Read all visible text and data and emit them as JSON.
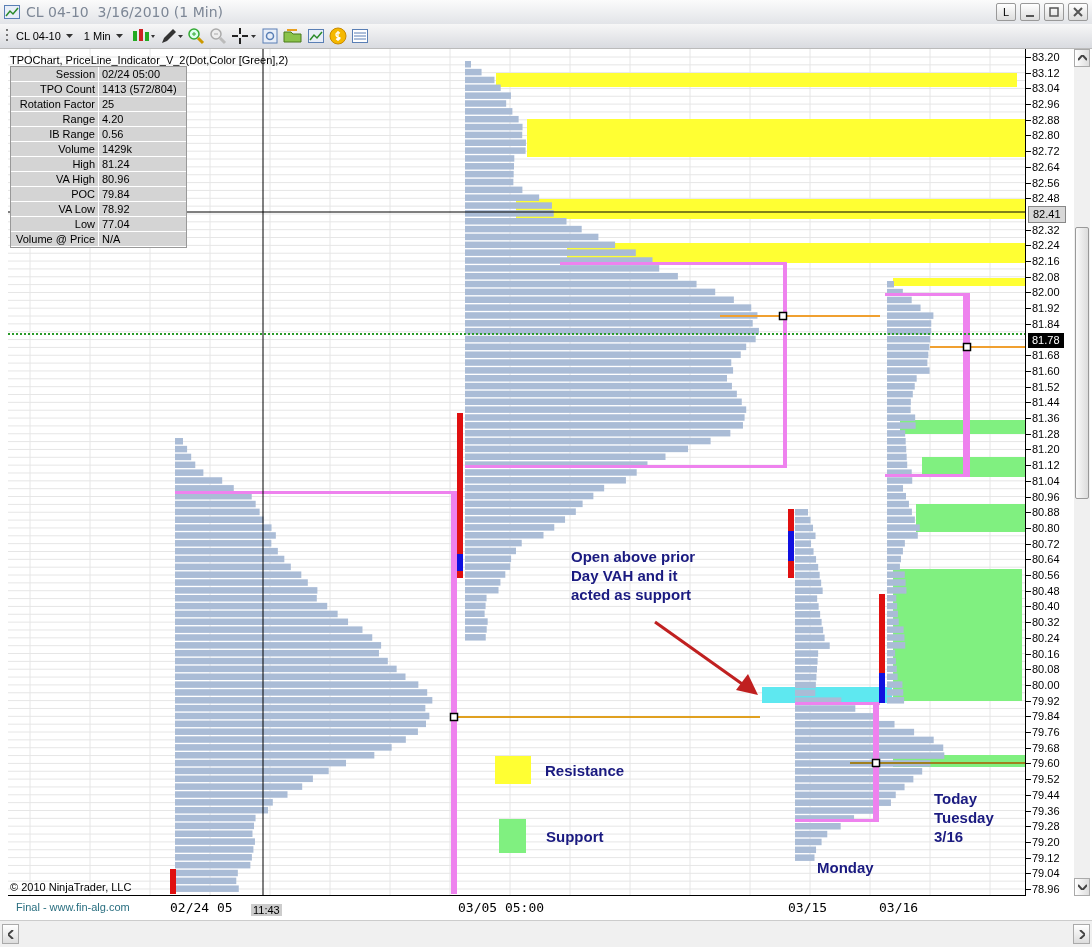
{
  "window": {
    "title": "CL 04-10  3/16/2010 (1 Min)",
    "buttons": [
      {
        "kind": "link",
        "label": "L"
      },
      {
        "kind": "minimize"
      },
      {
        "kind": "maximize"
      },
      {
        "kind": "close"
      }
    ]
  },
  "toolbar": {
    "instrument": "CL 04-10",
    "interval": "1 Min"
  },
  "chart": {
    "indicator_label": "TPOChart, PriceLine_Indicator_V_2(Dot,Color [Green],2)",
    "info_table": [
      {
        "label": "Session",
        "value": "02/24 05:00"
      },
      {
        "label": "TPO Count",
        "value": "1413 (572/804)"
      },
      {
        "label": "Rotation Factor",
        "value": "25"
      },
      {
        "label": "Range",
        "value": "4.20"
      },
      {
        "label": "IB Range",
        "value": "0.56"
      },
      {
        "label": "Volume",
        "value": "1429k"
      },
      {
        "label": "High",
        "value": "81.24"
      },
      {
        "label": "VA High",
        "value": "80.96"
      },
      {
        "label": "POC",
        "value": "79.84"
      },
      {
        "label": "VA Low",
        "value": "78.92"
      },
      {
        "label": "Low",
        "value": "77.04"
      },
      {
        "label": "Volume @ Price",
        "value": "N/A"
      }
    ],
    "note_lines": [
      "Open above prior",
      "Day VAH and it",
      "acted as support"
    ],
    "legend": [
      {
        "label": "Resistance",
        "color": "#ffff33"
      },
      {
        "label": "Support",
        "color": "#80f080"
      }
    ],
    "day_label": "Monday",
    "today_lines": [
      "Today",
      "Tuesday",
      "3/16"
    ],
    "copyright": "© 2010 NinjaTrader, LLC"
  },
  "price_axis": [
    {
      "label": "83.20",
      "kind": "tick"
    },
    {
      "label": "83.12",
      "kind": "tick"
    },
    {
      "label": "83.04",
      "kind": "tick"
    },
    {
      "label": "82.96",
      "kind": "tick"
    },
    {
      "label": "82.88",
      "kind": "tick"
    },
    {
      "label": "82.80",
      "kind": "tick"
    },
    {
      "label": "82.72",
      "kind": "tick"
    },
    {
      "label": "82.64",
      "kind": "tick"
    },
    {
      "label": "82.56",
      "kind": "tick"
    },
    {
      "label": "82.48",
      "kind": "tick"
    },
    {
      "label": "82.41",
      "kind": "last"
    },
    {
      "label": "82.32",
      "kind": "tick"
    },
    {
      "label": "82.24",
      "kind": "tick"
    },
    {
      "label": "82.16",
      "kind": "tick"
    },
    {
      "label": "82.08",
      "kind": "tick"
    },
    {
      "label": "82.00",
      "kind": "tick"
    },
    {
      "label": "81.92",
      "kind": "tick"
    },
    {
      "label": "81.84",
      "kind": "tick"
    },
    {
      "label": "81.78",
      "kind": "current"
    },
    {
      "label": "81.68",
      "kind": "tick"
    },
    {
      "label": "81.60",
      "kind": "tick"
    },
    {
      "label": "81.52",
      "kind": "tick"
    },
    {
      "label": "81.44",
      "kind": "tick"
    },
    {
      "label": "81.36",
      "kind": "tick"
    },
    {
      "label": "81.28",
      "kind": "tick"
    },
    {
      "label": "81.20",
      "kind": "tick"
    },
    {
      "label": "81.12",
      "kind": "tick"
    },
    {
      "label": "81.04",
      "kind": "tick"
    },
    {
      "label": "80.96",
      "kind": "tick"
    },
    {
      "label": "80.88",
      "kind": "tick"
    },
    {
      "label": "80.80",
      "kind": "tick"
    },
    {
      "label": "80.72",
      "kind": "tick"
    },
    {
      "label": "80.64",
      "kind": "tick"
    },
    {
      "label": "80.56",
      "kind": "tick"
    },
    {
      "label": "80.48",
      "kind": "tick"
    },
    {
      "label": "80.40",
      "kind": "tick"
    },
    {
      "label": "80.32",
      "kind": "tick"
    },
    {
      "label": "80.24",
      "kind": "tick"
    },
    {
      "label": "80.16",
      "kind": "tick"
    },
    {
      "label": "80.08",
      "kind": "tick"
    },
    {
      "label": "80.00",
      "kind": "tick"
    },
    {
      "label": "79.92",
      "kind": "tick"
    },
    {
      "label": "79.84",
      "kind": "tick"
    },
    {
      "label": "79.76",
      "kind": "tick"
    },
    {
      "label": "79.68",
      "kind": "tick"
    },
    {
      "label": "79.60",
      "kind": "tick"
    },
    {
      "label": "79.52",
      "kind": "tick"
    },
    {
      "label": "79.44",
      "kind": "tick"
    },
    {
      "label": "79.36",
      "kind": "tick"
    },
    {
      "label": "79.28",
      "kind": "tick"
    },
    {
      "label": "79.20",
      "kind": "tick"
    },
    {
      "label": "79.12",
      "kind": "tick"
    },
    {
      "label": "79.04",
      "kind": "tick"
    },
    {
      "label": "78.96",
      "kind": "tick"
    }
  ],
  "time_axis": {
    "labels": [
      "02/24 05",
      "03/05 05:00",
      "03/15",
      "03/16"
    ],
    "crosshair_time": "11:43"
  },
  "footer": "Final - www.fin-alg.com"
}
